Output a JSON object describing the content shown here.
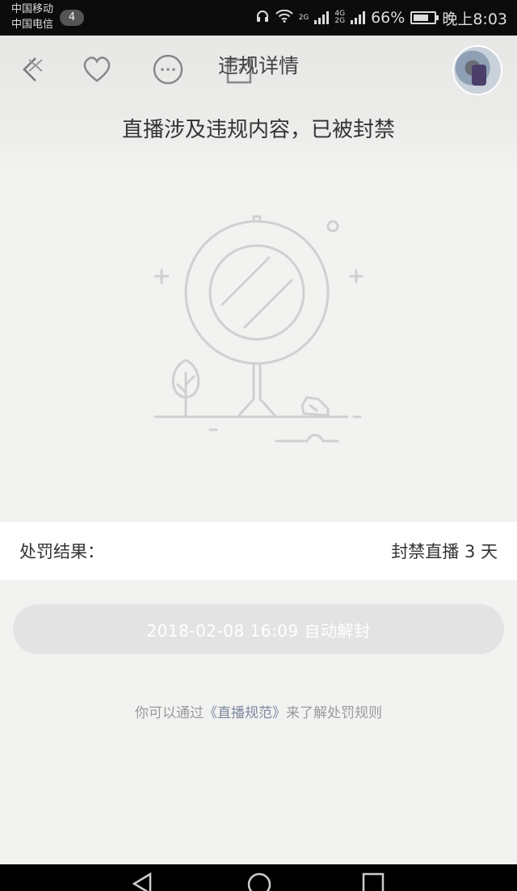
{
  "status_bar": {
    "carrier1": "中国移动",
    "carrier2": "中国电信",
    "notification_count": "4",
    "net1": "2G",
    "net2": "4G",
    "net3": "2G",
    "battery_percent": "66%",
    "time": "晚上8:03"
  },
  "header": {
    "title": "违规详情",
    "headline": "直播涉及违规内容，已被封禁"
  },
  "result": {
    "label": "处罚结果：",
    "value": "封禁直播 3 天"
  },
  "unban": {
    "label": "2018-02-08 16:09 自动解封"
  },
  "rules": {
    "prefix": "你可以通过",
    "link": "《直播规范》",
    "suffix": "来了解处罚规则"
  },
  "colors": {
    "background": "#f2f2f0",
    "button_disabled": "#e3e3e3",
    "link": "#7e8aa0"
  }
}
